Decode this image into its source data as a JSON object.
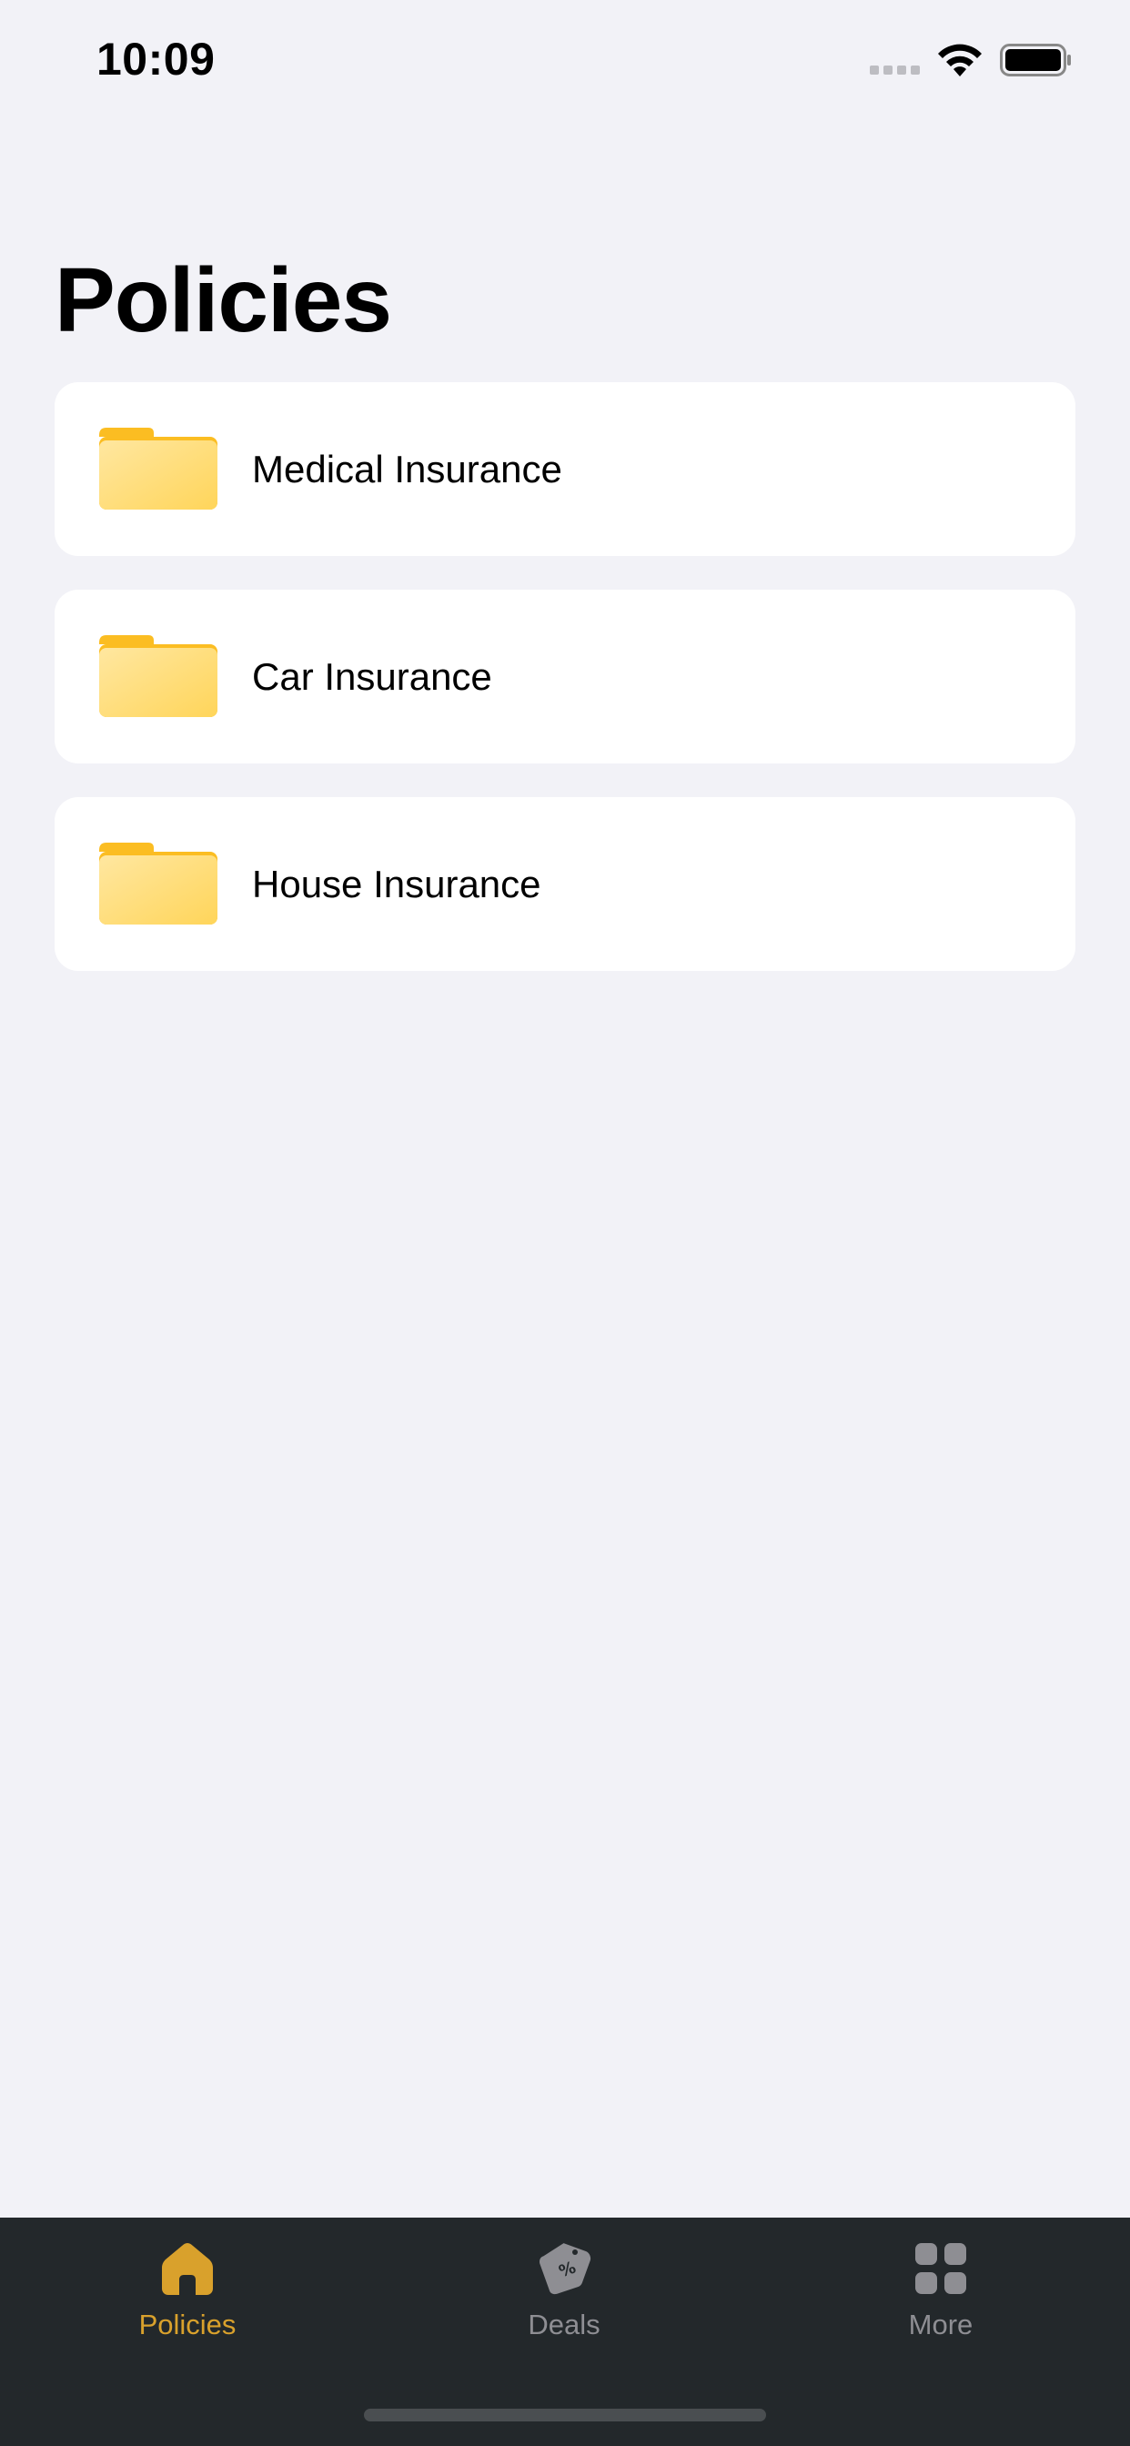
{
  "status_bar": {
    "time": "10:09"
  },
  "page": {
    "title": "Policies"
  },
  "policies": [
    {
      "label": "Medical Insurance",
      "icon": "folder-icon"
    },
    {
      "label": "Car Insurance",
      "icon": "folder-icon"
    },
    {
      "label": "House Insurance",
      "icon": "folder-icon"
    }
  ],
  "tab_bar": {
    "tabs": [
      {
        "label": "Policies",
        "icon": "home-icon",
        "active": true
      },
      {
        "label": "Deals",
        "icon": "tag-icon",
        "active": false
      },
      {
        "label": "More",
        "icon": "grid-icon",
        "active": false
      }
    ]
  },
  "colors": {
    "background": "#F2F2F7",
    "card": "#FFFFFF",
    "accent": "#D9A12C",
    "tab_bar": "#23282B",
    "inactive": "#8E8E93",
    "folder": "#FFD86B"
  }
}
